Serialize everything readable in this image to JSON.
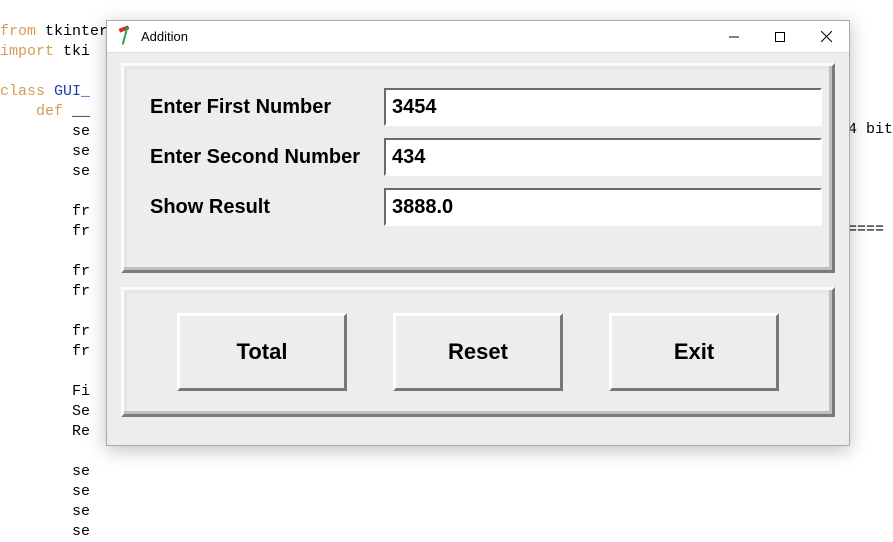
{
  "code": {
    "line1a": "from",
    "line1b": "tkinter",
    "line1c": "import",
    "line1d": "*",
    "line2a": "import",
    "line2b": "tki",
    "line4a": "class",
    "line4b": "GUI_",
    "line5a": "def",
    "line5b": "__",
    "se": "se",
    "fr": "fr",
    "Fi": "Fi",
    "Se": "Se",
    "Re": "Re"
  },
  "console": {
    "bit": "4 bit",
    "eq": "===="
  },
  "window": {
    "title": "Addition",
    "labels": {
      "first": "Enter First Number",
      "second": "Enter Second Number",
      "result": "Show Result"
    },
    "values": {
      "first": "3454",
      "second": "434",
      "result": "3888.0"
    },
    "buttons": {
      "total": "Total",
      "reset": "Reset",
      "exit": "Exit"
    }
  }
}
